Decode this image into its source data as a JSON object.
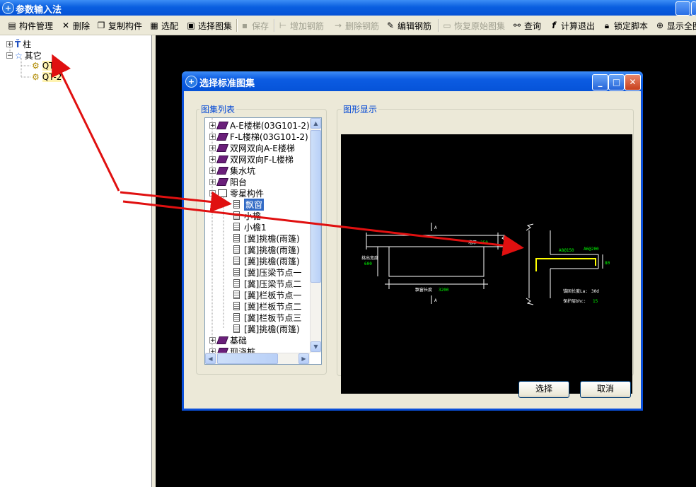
{
  "app": {
    "title": "参数输入法"
  },
  "toolbar": {
    "items": [
      {
        "label": "构件管理",
        "icon": "component-manage-icon",
        "enabled": true
      },
      {
        "label": "删除",
        "icon": "delete-x-icon",
        "enabled": true
      },
      {
        "label": "复制构件",
        "icon": "copy-icon",
        "enabled": true
      },
      {
        "label": "选配",
        "icon": "select-match-icon",
        "enabled": true
      },
      {
        "label": "选择图集",
        "icon": "atlas-icon",
        "enabled": true
      },
      {
        "label": "保存",
        "icon": "save-icon",
        "enabled": false
      },
      {
        "label": "增加钢筋",
        "icon": "add-rebar-icon",
        "enabled": false
      },
      {
        "label": "删除钢筋",
        "icon": "remove-rebar-icon",
        "enabled": false
      },
      {
        "label": "编辑钢筋",
        "icon": "edit-rebar-icon",
        "enabled": true
      },
      {
        "label": "恢复原始图集",
        "icon": "restore-icon",
        "enabled": false
      },
      {
        "label": "查询",
        "icon": "binoculars-icon",
        "enabled": true
      },
      {
        "label": "计算退出",
        "icon": "fx-icon",
        "enabled": true
      },
      {
        "label": "锁定脚本",
        "icon": "lock-icon",
        "enabled": true
      },
      {
        "label": "显示全图",
        "icon": "zoom-icon",
        "enabled": true
      }
    ]
  },
  "left_tree": {
    "nodes": [
      {
        "label": "柱",
        "level": 0,
        "expander": "+"
      },
      {
        "label": "其它",
        "level": 0,
        "expander": "−"
      },
      {
        "label": "QT-1",
        "level": 1
      },
      {
        "label": "QT-2",
        "level": 1
      }
    ]
  },
  "dialog": {
    "title": "选择标准图集",
    "list_group_label": "图集列表",
    "preview_group_label": "图形显示",
    "ok_button": "选择",
    "cancel_button": "取消",
    "tree": [
      {
        "label": "A-E楼梯(03G101-2)",
        "type": "book",
        "expander": "+"
      },
      {
        "label": "F-L楼梯(03G101-2)",
        "type": "book",
        "expander": "+"
      },
      {
        "label": "双网双向A-E楼梯",
        "type": "book",
        "expander": "+"
      },
      {
        "label": "双网双向F-L楼梯",
        "type": "book",
        "expander": "+"
      },
      {
        "label": "集水坑",
        "type": "book",
        "expander": "+"
      },
      {
        "label": "阳台",
        "type": "book",
        "expander": "+"
      },
      {
        "label": "零星构件",
        "type": "open-book",
        "expander": "−"
      },
      {
        "label": "飘窗",
        "type": "doc",
        "selected": true
      },
      {
        "label": "小檐",
        "type": "doc"
      },
      {
        "label": "小檐1",
        "type": "doc"
      },
      {
        "label": "[冀]挑檐(雨篷)",
        "type": "doc"
      },
      {
        "label": "[冀]挑檐(雨篷)",
        "type": "doc"
      },
      {
        "label": "[冀]挑檐(雨篷)",
        "type": "doc"
      },
      {
        "label": "[冀]压梁节点一",
        "type": "doc"
      },
      {
        "label": "[冀]压梁节点二",
        "type": "doc"
      },
      {
        "label": "[冀]栏板节点一",
        "type": "doc"
      },
      {
        "label": "[冀]栏板节点二",
        "type": "doc"
      },
      {
        "label": "[冀]栏板节点三",
        "type": "doc"
      },
      {
        "label": "[冀]挑檐(雨篷)",
        "type": "doc"
      },
      {
        "label": "基础",
        "type": "book",
        "expander": "+"
      },
      {
        "label": "现浇桩",
        "type": "book",
        "expander": "+"
      }
    ],
    "drawing": {
      "wall_thickness_label": "墙厚",
      "wall_thickness_value": "250",
      "protrude_label": "挑出宽度",
      "protrude_value": "600",
      "length_label": "飘窗长度",
      "length_value": "3200",
      "rebar1": "A8@150",
      "rebar2": "A6@200",
      "height_value": "80",
      "anchor_label": "锚固长度La:",
      "anchor_value": "30d",
      "cover_label": "保护层bhc:",
      "cover_value": "15",
      "mark": "A"
    }
  },
  "colors": {
    "titlebar": "#0a5fe0",
    "selection": "#316ac5",
    "arrow": "#e01010",
    "rebar": "#ffff00",
    "dim_text": "#00ff00"
  }
}
